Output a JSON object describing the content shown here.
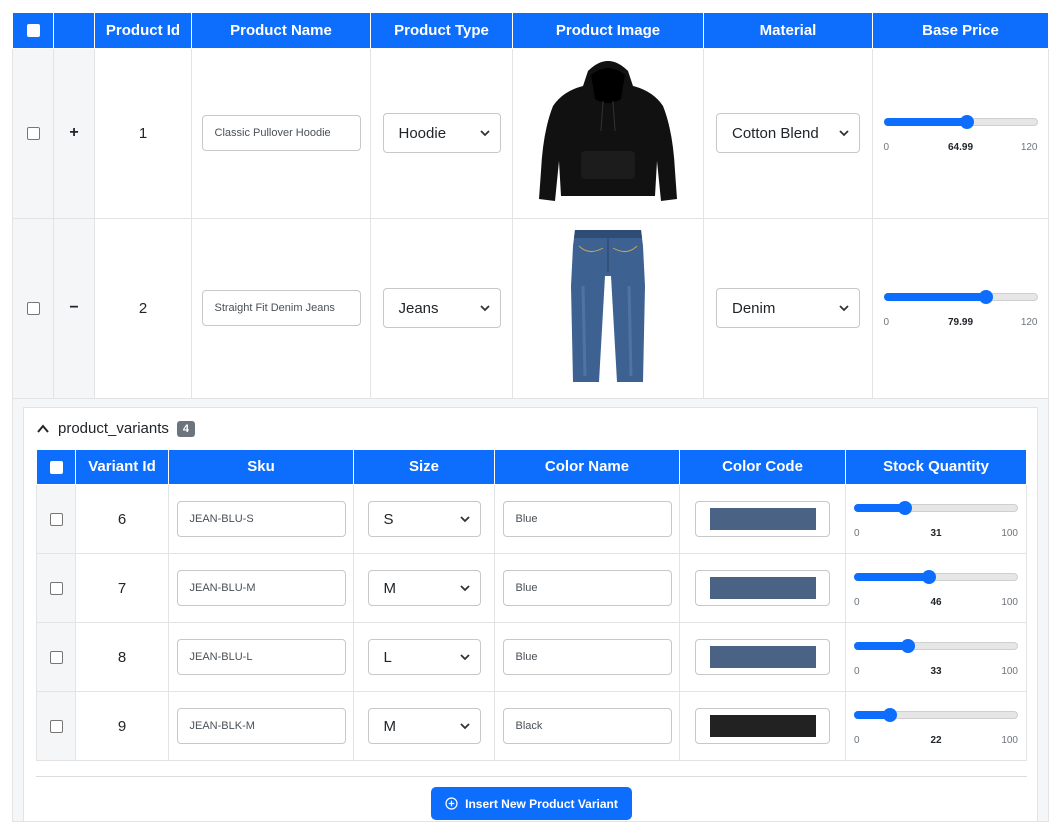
{
  "main": {
    "headers": {
      "product_id": "Product Id",
      "product_name": "Product Name",
      "product_type": "Product Type",
      "product_image": "Product Image",
      "material": "Material",
      "base_price": "Base Price"
    },
    "rows": [
      {
        "expander": "+",
        "id": "1",
        "name": "Classic Pullover Hoodie",
        "type": "Hoodie",
        "image_icon": "hoodie-image",
        "material": "Cotton Blend",
        "price": {
          "min": "0",
          "max": "120",
          "value": "64.99",
          "fraction": 0.5416
        }
      },
      {
        "expander": "−",
        "id": "2",
        "name": "Straight Fit Denim Jeans",
        "type": "Jeans",
        "image_icon": "jeans-image",
        "material": "Denim",
        "price": {
          "min": "0",
          "max": "120",
          "value": "79.99",
          "fraction": 0.6666
        }
      }
    ]
  },
  "variants": {
    "title": "product_variants",
    "count": "4",
    "headers": {
      "variant_id": "Variant Id",
      "sku": "Sku",
      "size": "Size",
      "color_name": "Color Name",
      "color_code": "Color Code",
      "stock": "Stock Quantity"
    },
    "rows": [
      {
        "id": "6",
        "sku": "JEAN-BLU-S",
        "size": "S",
        "color_name": "Blue",
        "color_code": "#4a6283",
        "stock": {
          "min": "0",
          "max": "100",
          "value": "31",
          "fraction": 0.31
        }
      },
      {
        "id": "7",
        "sku": "JEAN-BLU-M",
        "size": "M",
        "color_name": "Blue",
        "color_code": "#4a6283",
        "stock": {
          "min": "0",
          "max": "100",
          "value": "46",
          "fraction": 0.46
        }
      },
      {
        "id": "8",
        "sku": "JEAN-BLU-L",
        "size": "L",
        "color_name": "Blue",
        "color_code": "#4a6283",
        "stock": {
          "min": "0",
          "max": "100",
          "value": "33",
          "fraction": 0.33
        }
      },
      {
        "id": "9",
        "sku": "JEAN-BLK-M",
        "size": "M",
        "color_name": "Black",
        "color_code": "#222222",
        "stock": {
          "min": "0",
          "max": "100",
          "value": "22",
          "fraction": 0.22
        }
      }
    ],
    "insert_button_label": "Insert New Product Variant"
  },
  "colors": {
    "accent": "#0d6efd",
    "badge": "#6c757d"
  }
}
